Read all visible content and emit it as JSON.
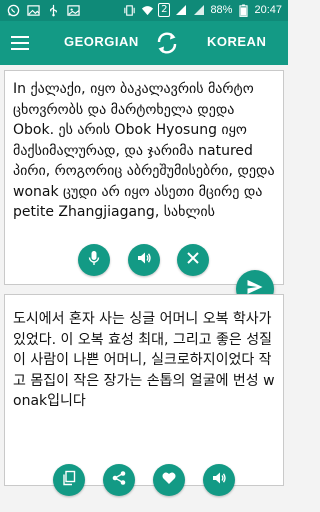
{
  "status_bar": {
    "left_icons": [
      "whatsapp-icon",
      "image-icon",
      "usb-icon",
      "image-icon"
    ],
    "right_icons": [
      "vibrate-icon",
      "wifi-icon",
      "sim-icon",
      "signal-icon",
      "signal-icon",
      "battery-icon"
    ],
    "sim_number": "2",
    "battery": "88%",
    "time": "20:47"
  },
  "toolbar": {
    "menu_icon": "hamburger-menu-icon",
    "source_language": "GEORGIAN",
    "swap_icon": "swap-languages-icon",
    "target_language": "KOREAN",
    "accent_color": "#139a85"
  },
  "source_panel": {
    "text": "In ქალაქი, იყო ბაკალავრის მარტო ცხოვრობს და მარტოხელა დედა Obok. ეს არის Obok Hyosung იყო მაქსიმალურად, და ჯარიმა natured პირი, როგორიც აბრეშუმისებრი, დედა wonak ცუდი არ იყო ასეთი მცირე და petite Zhangjiagang, სახლის",
    "buttons": [
      "microphone-icon",
      "speaker-icon",
      "clear-icon"
    ]
  },
  "translate_button": {
    "icon": "send-icon"
  },
  "target_panel": {
    "text": "도시에서 혼자 사는 싱글 어머니 오복 학사가 있었다. 이 오복 효성 최대, 그리고 좋은 성질이 사람이 나쁜 어머니, 실크로하지이었다 작고 몸집이 작은 장가는 손톱의 얼굴에 번성 wonak입니다",
    "buttons": [
      "copy-icon",
      "share-icon",
      "favorite-icon",
      "speaker-icon"
    ]
  }
}
